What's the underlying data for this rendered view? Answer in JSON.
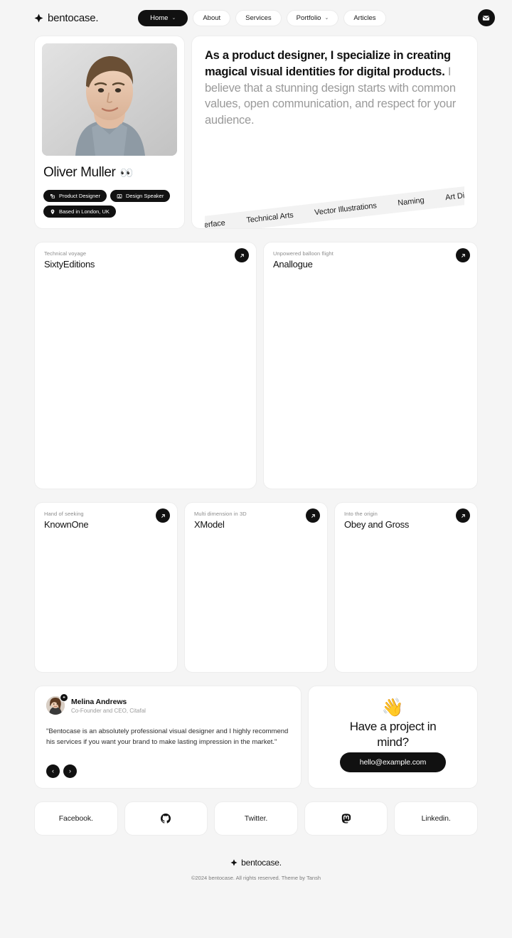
{
  "header": {
    "brand": "bentocase.",
    "brand_icon": "diamond-sparkle-icon",
    "nav": [
      {
        "label": "Home",
        "caret": "⌄",
        "active": true
      },
      {
        "label": "About",
        "caret": "",
        "active": false
      },
      {
        "label": "Services",
        "caret": "",
        "active": false
      },
      {
        "label": "Portfolio",
        "caret": "⌄",
        "active": false
      },
      {
        "label": "Articles",
        "caret": "",
        "active": false
      }
    ],
    "mail_button_icon": "envelope-icon"
  },
  "profile": {
    "photo_alt": "portrait-photo",
    "name": "Oliver Muller",
    "emoji": "👀",
    "tags": [
      {
        "label": "Product Designer",
        "icon": "pen-tool-icon"
      },
      {
        "label": "Design Speaker",
        "icon": "speaker-frame-icon"
      },
      {
        "label": "Based in London, UK",
        "icon": "map-pin-icon"
      }
    ]
  },
  "intro": {
    "strong": "As a product designer, I specialize in creating magical visual identities for digital products.",
    "rest": " I believe that a stunning design starts with common values, open communication, and respect for your audience.",
    "skills": [
      "User Interface",
      "Technical Arts",
      "Vector Illustrations",
      "Naming",
      "Art Direction"
    ]
  },
  "projects_row1": [
    {
      "kicker": "Technical voyage",
      "title": "SixtyEditions",
      "arrow_icon": "arrow-up-right-icon"
    },
    {
      "kicker": "Unpowered balloon flight",
      "title": "Anallogue",
      "arrow_icon": "arrow-up-right-icon"
    }
  ],
  "projects_row2": [
    {
      "kicker": "Hand of seeking",
      "title": "KnownOne",
      "arrow_icon": "arrow-up-right-icon"
    },
    {
      "kicker": "Multi dimension in 3D",
      "title": "XModel",
      "arrow_icon": "arrow-up-right-icon"
    },
    {
      "kicker": "Into the origin",
      "title": "Obey and Gross",
      "arrow_icon": "arrow-up-right-icon"
    }
  ],
  "testimonial": {
    "avatar_alt": "reviewer-avatar",
    "badge": "❝",
    "name": "Melina Andrews",
    "role": "Co-Founder and CEO, Citafal",
    "quote": "\"Bentocase is an absolutely professional visual designer and I highly recommend his services if you want your brand to make lasting impression in the market.\"",
    "prev_label": "‹",
    "next_label": "›"
  },
  "contact": {
    "emoji": "👋",
    "title": "Have a project in mind?",
    "email": "hello@example.com"
  },
  "socials": [
    {
      "label": "Facebook.",
      "icon": ""
    },
    {
      "label": "",
      "icon": "github-icon"
    },
    {
      "label": "Twitter.",
      "icon": ""
    },
    {
      "label": "",
      "icon": "mastodon-icon"
    },
    {
      "label": "Linkedin.",
      "icon": ""
    }
  ],
  "footer": {
    "brand": "bentocase.",
    "copyright": "©2024 bentocase. All rights reserved. Theme by Tansh"
  },
  "colors": {
    "page_bg": "#f5f5f5",
    "card_bg": "#ffffff",
    "accent": "#111111",
    "muted_text": "#9a9a9a",
    "border": "#ededed"
  }
}
